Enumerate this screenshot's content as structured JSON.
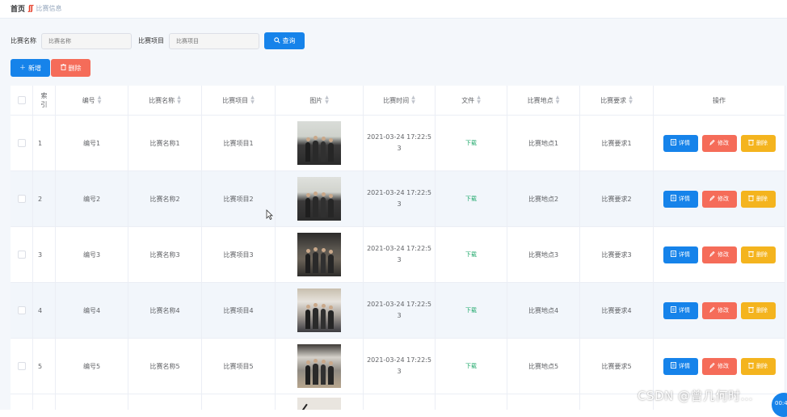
{
  "breadcrumb": {
    "home": "首页",
    "separator": "ʃʃ",
    "current": "比赛信息"
  },
  "filters": {
    "name_label": "比赛名称",
    "name_placeholder": "比赛名称",
    "project_label": "比赛项目",
    "project_placeholder": "比赛项目",
    "query_label": "查询"
  },
  "actions": {
    "add_label": "新增",
    "delete_label": "删除"
  },
  "table": {
    "headers": [
      "索引",
      "编号",
      "比赛名称",
      "比赛项目",
      "图片",
      "比赛时间",
      "文件",
      "比赛地点",
      "比赛要求",
      "操作"
    ],
    "rows": [
      {
        "index": "1",
        "code": "编号1",
        "name": "比赛名称1",
        "project": "比赛项目1",
        "time": "2021-03-24 17:22:53",
        "file": "下载",
        "place": "比赛地点1",
        "req": "比赛要求1"
      },
      {
        "index": "2",
        "code": "编号2",
        "name": "比赛名称2",
        "project": "比赛项目2",
        "time": "2021-03-24 17:22:53",
        "file": "下载",
        "place": "比赛地点2",
        "req": "比赛要求2"
      },
      {
        "index": "3",
        "code": "编号3",
        "name": "比赛名称3",
        "project": "比赛项目3",
        "time": "2021-03-24 17:22:53",
        "file": "下载",
        "place": "比赛地点3",
        "req": "比赛要求3"
      },
      {
        "index": "4",
        "code": "编号4",
        "name": "比赛名称4",
        "project": "比赛项目4",
        "time": "2021-03-24 17:22:53",
        "file": "下载",
        "place": "比赛地点4",
        "req": "比赛要求4"
      },
      {
        "index": "5",
        "code": "编号5",
        "name": "比赛名称5",
        "project": "比赛项目5",
        "time": "2021-03-24 17:22:53",
        "file": "下载",
        "place": "比赛地点5",
        "req": "比赛要求5"
      }
    ],
    "row_buttons": {
      "detail": "详情",
      "edit": "修改",
      "delete": "删除"
    }
  },
  "overlay": {
    "watermark": "CSDN @曾几何时…",
    "bubble": "00:4"
  },
  "colors": {
    "primary": "#1683ea",
    "danger": "#f56c59",
    "warning": "#f4b41e",
    "success": "#21a96c"
  },
  "icons": [
    "search-icon",
    "plus-icon",
    "trash-icon",
    "document-icon",
    "edit-icon",
    "sort-icon",
    "mouse-cursor-icon"
  ]
}
